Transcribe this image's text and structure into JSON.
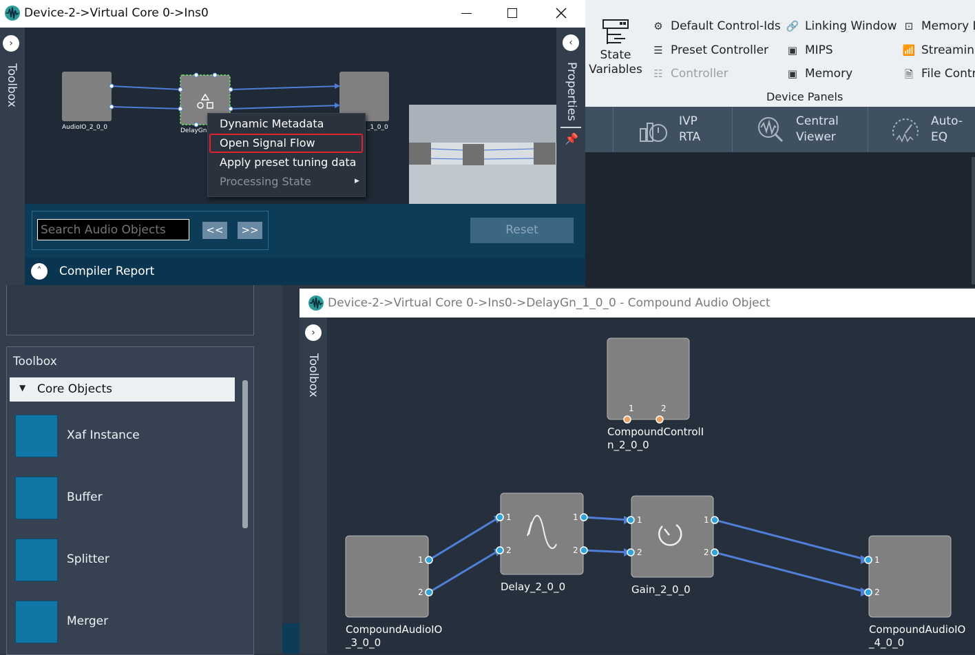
{
  "window1": {
    "title": "Device-2->Virtual Core 0->Ins0",
    "toolbox_label": "Toolbox",
    "properties_label": "Properties",
    "nodes": [
      "AudioIO_2_0_0",
      "DelayGn",
      "_1_0_0"
    ],
    "context_menu": {
      "items": [
        "Dynamic Metadata",
        "Open Signal Flow",
        "Apply preset tuning data",
        "Processing State"
      ]
    },
    "search_placeholder": "Search Audio Objects",
    "prev_label": "<<",
    "next_label": ">>",
    "reset_label": "Reset",
    "compiler_report": "Compiler Report"
  },
  "ribbon": {
    "state_variables": "State\nVariables",
    "items": {
      "default_control_ids": "Default Control-Ids",
      "linking_window": "Linking Window",
      "memory_l": "Memory L",
      "preset_controller": "Preset Controller",
      "mips": "MIPS",
      "streaming": "Streaming",
      "controller": "Controller",
      "memory": "Memory",
      "file_contr": "File Contr"
    },
    "group_label": "Device Panels",
    "tabs": [
      {
        "line1": "IVP",
        "line2": "RTA"
      },
      {
        "line1": "Central",
        "line2": "Viewer"
      },
      {
        "line1": "Auto-",
        "line2": "EQ"
      }
    ]
  },
  "toolbox": {
    "title": "Toolbox",
    "category": "Core Objects",
    "items": [
      "Xaf Instance",
      "Buffer",
      "Splitter",
      "Merger"
    ]
  },
  "window2": {
    "title": "Device-2->Virtual Core 0->Ins0->DelayGn_1_0_0 - Compound Audio Object",
    "toolbox_label": "Toolbox",
    "nodes": {
      "control_in": "CompoundControlI\nn_2_0_0",
      "audio_in": "CompoundAudioIO\n_3_0_0",
      "delay": "Delay_2_0_0",
      "gain": "Gain_2_0_0",
      "audio_out": "CompoundAudioIO\n_4_0_0"
    },
    "port_labels": [
      "1",
      "2"
    ]
  },
  "colors": {
    "accent_blue": "#0f76a6",
    "wire": "#4f7fd6",
    "port_orange": "#f0a060",
    "highlight_red": "#e0202a",
    "node_gray": "#808080"
  }
}
